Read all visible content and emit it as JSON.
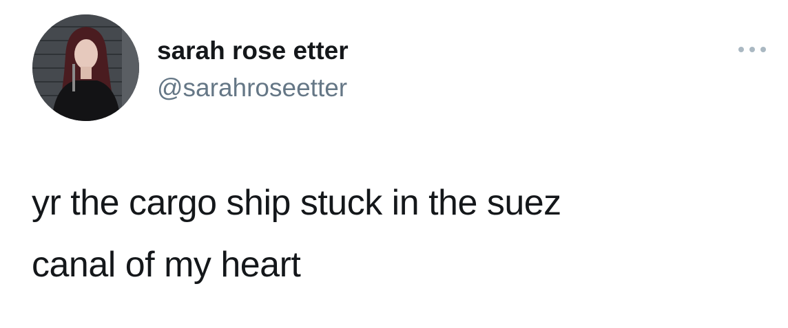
{
  "tweet": {
    "author": {
      "display_name": "sarah rose etter",
      "handle": "@sarahroseetter",
      "avatar_icon": "profile-photo"
    },
    "more_icon": "ellipsis-icon",
    "text": "yr the cargo ship stuck in the suez\ncanal of my heart"
  },
  "colors": {
    "text_primary": "#14171a",
    "text_secondary": "#657786",
    "more_dots": "#aab8c2",
    "background": "#ffffff"
  }
}
